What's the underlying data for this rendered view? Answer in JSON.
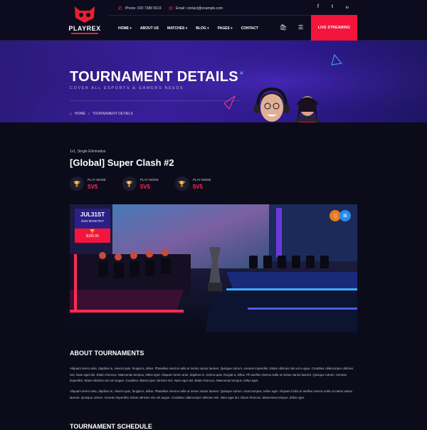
{
  "header": {
    "logo_text": "PLAYREX",
    "phone": "Phone: 020 7388 5619",
    "email": "Email: contact@example.com",
    "social": [
      "f",
      "t",
      "in"
    ],
    "nav": [
      "HOME ▾",
      "ABOUT US",
      "MATCHES ▾",
      "BLOG ▾",
      "PAGES ▾",
      "CONTACT"
    ],
    "live_button": "LIVE STREAMING"
  },
  "hero": {
    "title": "TOURNAMENT DETAILS",
    "subtitle": "COVER ALL ESPORTS & GAMERS NEEDS",
    "breadcrumb_home": "HOME",
    "breadcrumb_current": "TOURNAMENT DETAILS"
  },
  "tournament": {
    "meta": "1v1, Single Elimination",
    "title": "[Global] Super Clash #2",
    "modes": [
      {
        "label": "PLAY MODE",
        "value": "5V5"
      },
      {
        "label": "PLAY MODE",
        "value": "5V5"
      },
      {
        "label": "PLAY MODE",
        "value": "5V5"
      }
    ],
    "date": "JUL31ST",
    "time": "SUN 00:00 PKT",
    "prize": "$150.00"
  },
  "about": {
    "heading": "ABOUT TOURNAMENTS",
    "para1": "Aliquam lorem ante, dapibus in, viverra quis, feugiat a, tellus. Phasellus viverra nulla ut metus varius laoreet. Quisque rutrum. Aenean imperdiet. Etiam ultricies nisi vel a ugue. Curabitur ullamcorper ultricies nisi. Nam eget dui. Etiam rhoncus. Maecenas tempus, tellus eget. Aliquam lorem ante, dapibus in, viverra quis, feugiat a, tellus. Ph asellus viverra nulla ut metus varius laoreet. Quisque rutrum. Aenean imperdiet. Etiam ultricies nisi vel augue. Curabitur ullamcorper ultricies nisi. Nam eget dui. Etiam rhoncus. Maecenas tempus, tellus eget.",
    "para2": "Aliquam lorem ante, dapibus in, viverra quis, feugiat a, tellus. Phasellus viverra nulla ut metus varius laoreet. Quisque rutrum. Anas tempus, tellus eget. Aliquam loolis.m asellus viverra nulla ut metus varius laoreet. Quisque rutrum. Aenean imperdiet. Etiam ultricies nisi vel augue. Curabitur ullamcorper ultricies nisi. Nam eget dui. Etiam rhoncus. Maecenas tempus, tellus eget."
  },
  "schedule": {
    "heading": "TOURNAMENT SCHEDULE"
  }
}
